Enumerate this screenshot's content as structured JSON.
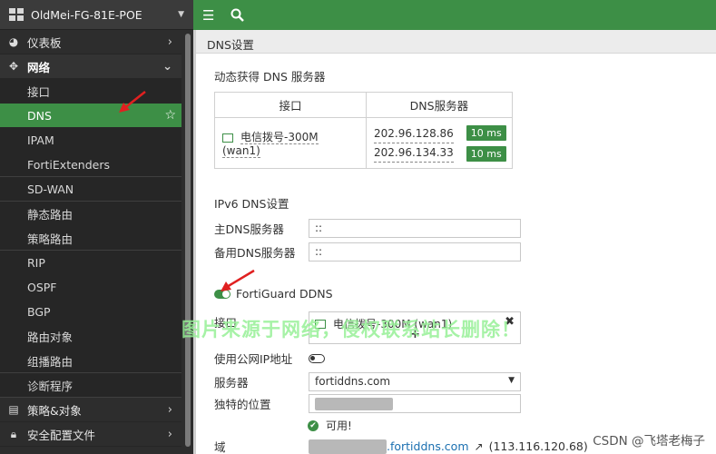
{
  "device": {
    "name": "OldMei-FG-81E-POE"
  },
  "sidebar": {
    "items": [
      {
        "label": "仪表板",
        "icon": "dashboard-icon"
      },
      {
        "label": "网络",
        "icon": "network-icon"
      },
      {
        "label": "接口"
      },
      {
        "label": "DNS"
      },
      {
        "label": "IPAM"
      },
      {
        "label": "FortiExtenders"
      },
      {
        "label": "SD-WAN"
      },
      {
        "label": "静态路由"
      },
      {
        "label": "策略路由"
      },
      {
        "label": "RIP"
      },
      {
        "label": "OSPF"
      },
      {
        "label": "BGP"
      },
      {
        "label": "路由对象"
      },
      {
        "label": "组播路由"
      },
      {
        "label": "诊断程序"
      },
      {
        "label": "策略&对象",
        "icon": "policy-icon"
      },
      {
        "label": "安全配置文件",
        "icon": "lock-icon"
      }
    ]
  },
  "page": {
    "title": "DNS设置"
  },
  "dynamic": {
    "title": "动态获得 DNS 服务器",
    "col_interface": "接口",
    "col_dns": "DNS服务器",
    "interface": "电信拨号-300M (wan1)",
    "ip1": "202.96.128.86",
    "ip2": "202.96.134.33",
    "ms1": "10 ms",
    "ms2": "10 ms"
  },
  "ipv6": {
    "title": "IPv6 DNS设置",
    "primary_label": "主DNS服务器",
    "primary_value": "::",
    "secondary_label": "备用DNS服务器",
    "secondary_value": "::"
  },
  "ddns": {
    "title": "FortiGuard DDNS",
    "interface_label": "接口",
    "interface_value": "电信拨号-300M (wan1)",
    "public_ip_label": "使用公网IP地址",
    "server_label": "服务器",
    "server_value": "fortiddns.com",
    "unique_label": "独特的位置",
    "available": "可用!",
    "domain_label": "域",
    "domain_suffix": ".fortiddns.com",
    "domain_ip": "(113.116.120.68)"
  },
  "overlay": {
    "watermark": "图片来源于网络，侵权联系站长删除！",
    "csdn": "CSDN @飞塔老梅子"
  },
  "colors": {
    "accent": "#3d8f46",
    "sidebar": "#2d2d2d",
    "link": "#1a6fb0",
    "annotation": "#e02020"
  }
}
